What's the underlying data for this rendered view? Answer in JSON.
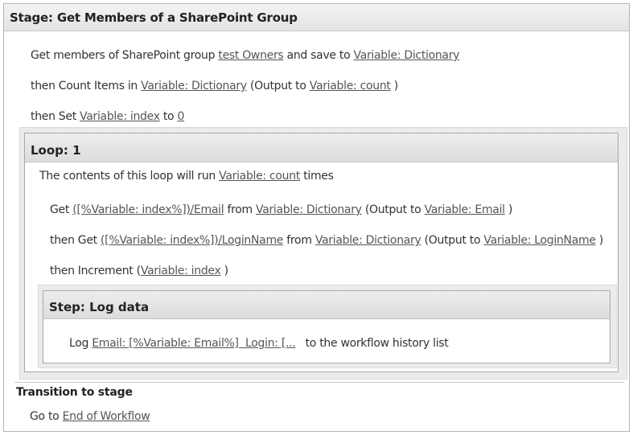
{
  "stage": {
    "label": "Stage:",
    "name": "Get Members of a SharePoint Group"
  },
  "actions": {
    "get_members": {
      "prefix": "Get members of SharePoint group",
      "group": "test Owners",
      "mid": "and save to",
      "var": "Variable: Dictionary"
    },
    "count": {
      "prefix": "then Count Items in",
      "dict": "Variable: Dictionary",
      "mid": "(Output to",
      "out": "Variable: count",
      "suffix": ")"
    },
    "set_index": {
      "prefix": "then Set",
      "var": "Variable: index",
      "mid": "to",
      "value": "0"
    }
  },
  "loop": {
    "title": "Loop: 1",
    "desc_prefix": "The contents of this loop will run",
    "desc_var": "Variable: count",
    "desc_suffix": "times",
    "get_email": {
      "prefix": "Get",
      "path": "([%Variable: index%])/Email",
      "from": "from",
      "dict": "Variable: Dictionary",
      "out_prefix": "(Output to",
      "out": "Variable: Email",
      "suffix": ")"
    },
    "get_login": {
      "prefix": "then Get",
      "path": "([%Variable: index%])/LoginName",
      "from": "from",
      "dict": "Variable: Dictionary",
      "out_prefix": "(Output to",
      "out": "Variable: LoginName",
      "suffix": ")"
    },
    "increment": {
      "prefix": "then Increment",
      "open": "(",
      "var": "Variable: index",
      "close": ")"
    }
  },
  "step": {
    "title": "Step: Log data",
    "log_prefix": "Log",
    "log_message": "Email: [%Variable: Email%]  Login: [...",
    "log_suffix": "to the workflow history list"
  },
  "transition": {
    "title": "Transition to stage",
    "goto_prefix": "Go to",
    "target": "End of Workflow"
  }
}
